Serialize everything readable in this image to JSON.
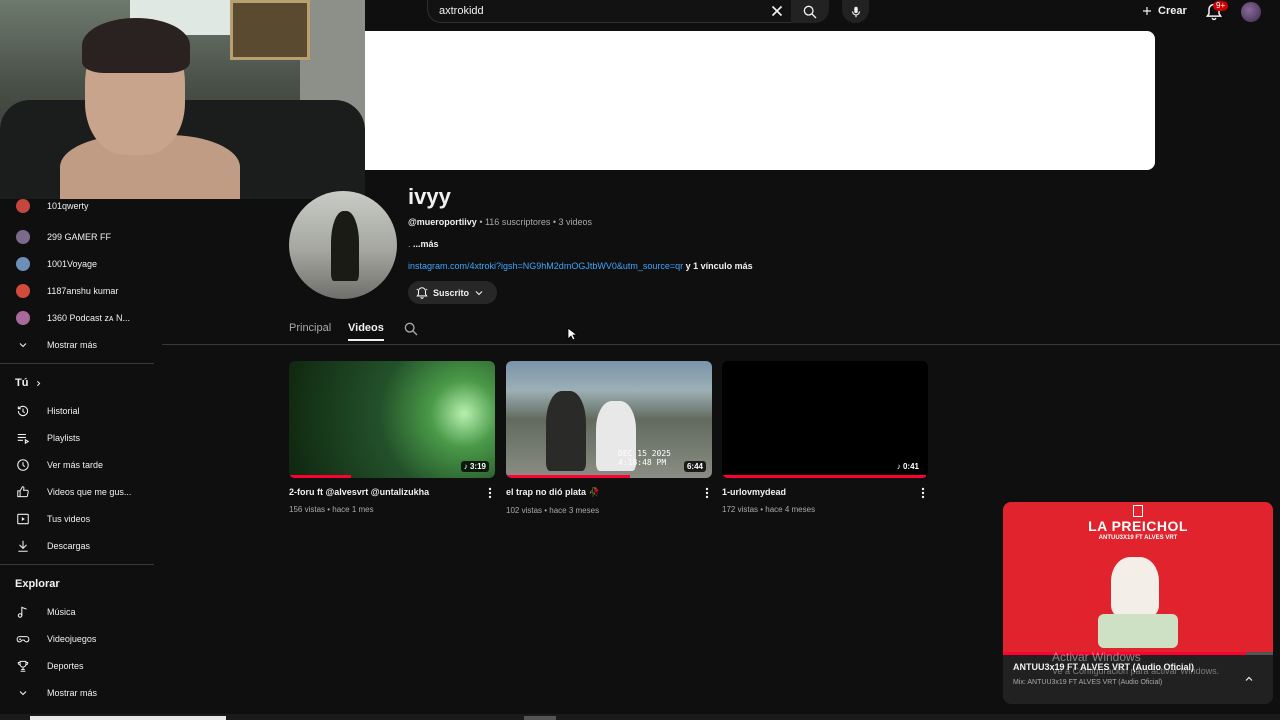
{
  "topbar": {
    "search_value": "axtrokidd",
    "create_label": "Crear",
    "notifications_badge": "9+"
  },
  "channel": {
    "name": "ivyy",
    "handle": "@mueroportiivy",
    "subscribers": "116 suscriptores",
    "videos_count": "3 videos",
    "desc_prefix": ".",
    "desc_more": "...más",
    "link": "instagram.com/4xtroki?igsh=NG9hM2dmOGJtbWV0&utm_source=qr",
    "more_links": "y 1 vínculo más",
    "subscribe_label": "Suscrito"
  },
  "tabs": [
    "Principal",
    "Videos"
  ],
  "videos": [
    {
      "title": "2-foru ft @alvesvrt @untalizukha",
      "meta": "156 vistas • hace 1 mes",
      "duration": "3:19",
      "watched": 0.3
    },
    {
      "title": "el trap no dió plata 🥀",
      "meta": "102 vistas • hace 3 meses",
      "duration": "6:44",
      "watched": 0.6,
      "stamp": "DEC 15 2025\n4:18:48 PM"
    },
    {
      "title": "1-urlovmydead",
      "meta": "172 vistas • hace 4 meses",
      "duration": "0:41",
      "watched": 0.99
    }
  ],
  "sidebar": {
    "subscriptions": [
      {
        "label": "101qwerty",
        "color": "#c4463e"
      },
      {
        "label": "299 GAMER FF",
        "color": "#7c6a8c"
      },
      {
        "label": "1001Voyage",
        "color": "#6b8fb7"
      },
      {
        "label": "1187anshu kumar",
        "color": "#d24a3a"
      },
      {
        "label": "1360 Podcast ᴢᴀ N...",
        "color": "#a86a9a"
      }
    ],
    "show_more_1": "Mostrar más",
    "you_heading": "Tú",
    "you_items": [
      {
        "label": "Historial",
        "icon": "history-icon"
      },
      {
        "label": "Playlists",
        "icon": "playlists-icon"
      },
      {
        "label": "Ver más tarde",
        "icon": "clock-icon"
      },
      {
        "label": "Videos que me gus...",
        "icon": "thumbs-up-icon"
      },
      {
        "label": "Tus videos",
        "icon": "your-videos-icon"
      },
      {
        "label": "Descargas",
        "icon": "download-icon"
      }
    ],
    "explore_heading": "Explorar",
    "explore_items": [
      {
        "label": "Música",
        "icon": "music-icon"
      },
      {
        "label": "Videojuegos",
        "icon": "gaming-icon"
      },
      {
        "label": "Deportes",
        "icon": "trophy-icon"
      }
    ],
    "show_more_2": "Mostrar más"
  },
  "miniplayer": {
    "art_title": "LA PREICHOL",
    "art_subtitle": "ANTUU3X19 FT ALVES VRT",
    "title": "ANTUU3x19 FT ALVES VRT (Audio Oficial)",
    "subtitle": "Mix: ANTUU3x19 FT ALVES VRT (Audio Oficial)",
    "progress": 0.9
  },
  "watermark": {
    "title": "Activar Windows",
    "subtitle": "Ve a Configuración para activar Windows."
  },
  "colors": {
    "accent": "#ff0033",
    "link": "#3ea6ff",
    "background": "#0f0f0f"
  }
}
